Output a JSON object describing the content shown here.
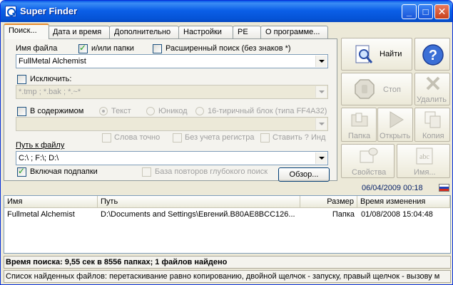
{
  "window": {
    "title": "Super Finder"
  },
  "tabs": [
    {
      "label": "Поиск..."
    },
    {
      "label": "Дата и время"
    },
    {
      "label": "Дополнительно"
    },
    {
      "label": "Настройки"
    },
    {
      "label": "PE"
    },
    {
      "label": "О программе..."
    }
  ],
  "search": {
    "filename_label": "Имя файла",
    "and_or_folders_label": "и/или папки",
    "extended_search_label": "Расширенный поиск (без знаков *)",
    "filename_value": "FullMetal Alchemist",
    "exclude_label": "Исключить:",
    "exclude_value": "*.tmp ; *.bak ; *.~*",
    "content_label": "В содержимом",
    "radio_text": "Текст",
    "radio_unicode": "Юникод",
    "radio_hex": "16-тиричный блок (типа FF4A32)",
    "content_value": "",
    "whole_words_label": "Слова точно",
    "case_insensitive_label": "Без учета регистра",
    "put_question_label": "Ставить ? Инд",
    "path_label": "Путь к файлу",
    "path_value": "C:\\ ; F:\\; D:\\",
    "include_subfolders_label": "Включая подпапки",
    "deep_search_label": "База повторов глубокого поиск",
    "browse_label": "Обзор..."
  },
  "buttons": {
    "find": "Найти",
    "help": "",
    "stop": "Стоп",
    "delete": "Удалить",
    "folder": "Папка",
    "open": "Открыть",
    "copy": "Копия",
    "properties": "Свойства",
    "name": "Имя..."
  },
  "datetime": "06/04/2009 00:18",
  "results": {
    "columns": [
      "Имя",
      "Путь",
      "Размер",
      "Время изменения"
    ],
    "rows": [
      {
        "name": "Fullmetal Alchemist",
        "path": "D:\\Documents and Settings\\Евгений.B80AE8BCC126...",
        "size": "Папка",
        "modified": "01/08/2008 15:04:48"
      }
    ]
  },
  "status": {
    "summary": "Время поиска: 9,55 сек в 8556 папках; 1 файлов найдено",
    "hint": "Список найденных файлов: перетаскивание равно копированию, двойной щелчок - запуску, правый щелчок - вызову м"
  },
  "colors": {
    "titlebar": "#0553d6",
    "window_bg": "#ece9d8",
    "active_tab_accent": "#e68b2c"
  }
}
